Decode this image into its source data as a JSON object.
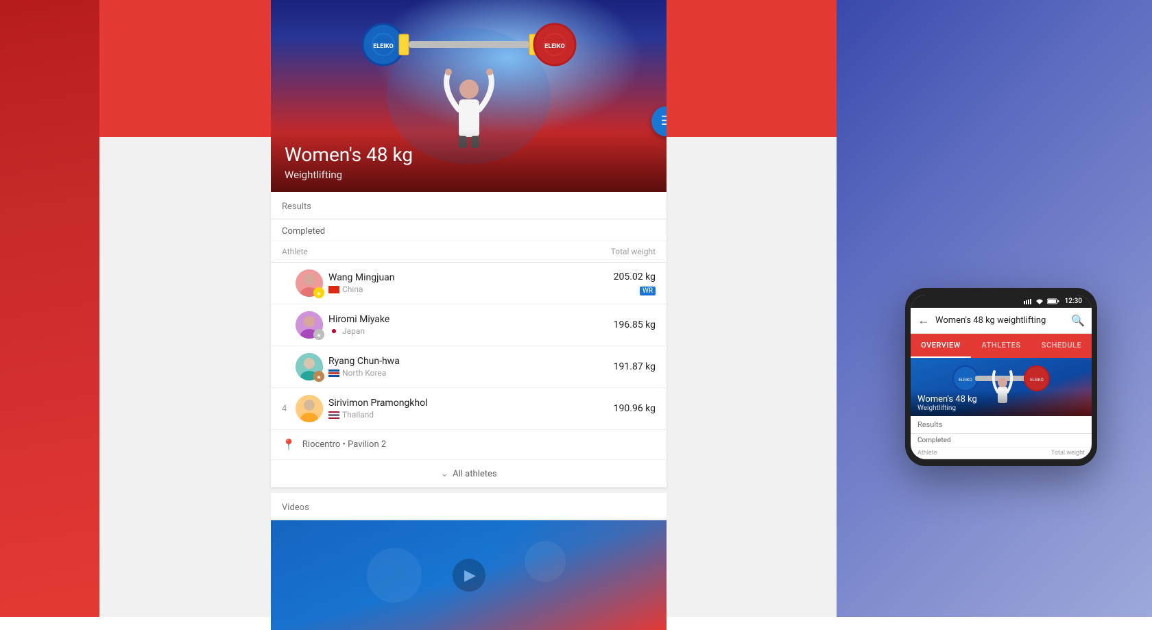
{
  "backgrounds": {
    "left_color": "#c62828",
    "right_color": "#5c6bc0",
    "center_top_color": "#e53935",
    "center_bottom_color": "#f1f1f1"
  },
  "hero": {
    "title": "Women's 48 kg",
    "subtitle": "Weightlifting"
  },
  "fab": {
    "icon": "☰"
  },
  "results": {
    "section_title": "Results",
    "status": "Completed",
    "table_headers": {
      "athlete": "Athlete",
      "total_weight": "Total weight"
    },
    "athletes": [
      {
        "rank": "1",
        "name": "Wang Mingjuan",
        "country": "China",
        "flag": "china",
        "medal": "gold",
        "weight": "205.02 kg",
        "badge": "WR"
      },
      {
        "rank": "2",
        "name": "Hiromi Miyake",
        "country": "Japan",
        "flag": "japan",
        "medal": "silver",
        "weight": "196.85 kg",
        "badge": ""
      },
      {
        "rank": "3",
        "name": "Ryang Chun-hwa",
        "country": "North Korea",
        "flag": "nkorea",
        "medal": "bronze",
        "weight": "191.87 kg",
        "badge": ""
      },
      {
        "rank": "4",
        "name": "Sirivimon Pramongkhol",
        "country": "Thailand",
        "flag": "thailand",
        "medal": "",
        "weight": "190.96 kg",
        "badge": ""
      }
    ],
    "location": "Riocentro • Pavilion 2",
    "all_athletes_label": "All athletes"
  },
  "videos": {
    "section_title": "Videos"
  },
  "phone": {
    "status_bar": {
      "time": "12:30"
    },
    "search_text": "Women's 48 kg weightlifting",
    "tabs": [
      "OVERVIEW",
      "ATHLETES",
      "SCHEDULE"
    ],
    "active_tab": "OVERVIEW",
    "hero_title": "Women's 48 kg",
    "hero_subtitle": "Weightlifting",
    "results_label": "Results",
    "completed_label": "Completed",
    "athlete_col": "Athlete",
    "weight_col": "Total weight"
  }
}
